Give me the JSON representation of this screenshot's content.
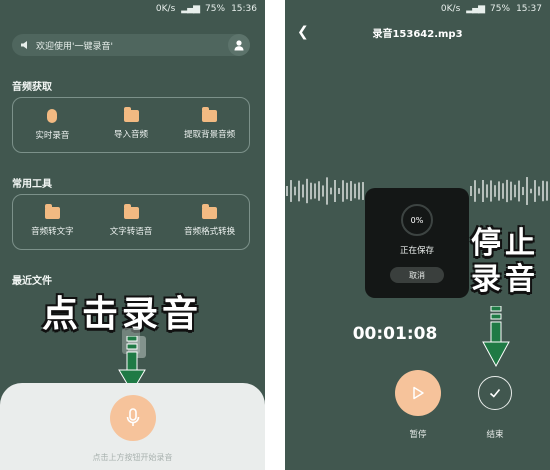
{
  "left": {
    "status": {
      "speed": "0K/s",
      "battery": "75%",
      "time": "15:36"
    },
    "welcome_text": "欢迎使用'一键录音'",
    "sections": {
      "audio_title": "音频获取",
      "tools_title": "常用工具",
      "recent_title": "最近文件"
    },
    "audio_items": [
      "实时录音",
      "导入音频",
      "提取背景音频"
    ],
    "tool_items": [
      "音频转文字",
      "文字转语音",
      "音频格式转换"
    ],
    "annotation": "点击录音",
    "record_hint": "点击上方按钮开始录音"
  },
  "right": {
    "status": {
      "speed": "0K/s",
      "battery": "75%",
      "time": "15:37"
    },
    "title": "录音153642.mp3",
    "dialog": {
      "progress": "0%",
      "status": "正在保存",
      "cancel": "取消"
    },
    "annotation_line1": "停止",
    "annotation_line2": "录音",
    "timer": "00:01:08",
    "pause_label": "暂停",
    "finish_label": "结束"
  },
  "colors": {
    "background": "#41574f",
    "accent": "#f6c39b",
    "arrow": "#1f7a45"
  }
}
